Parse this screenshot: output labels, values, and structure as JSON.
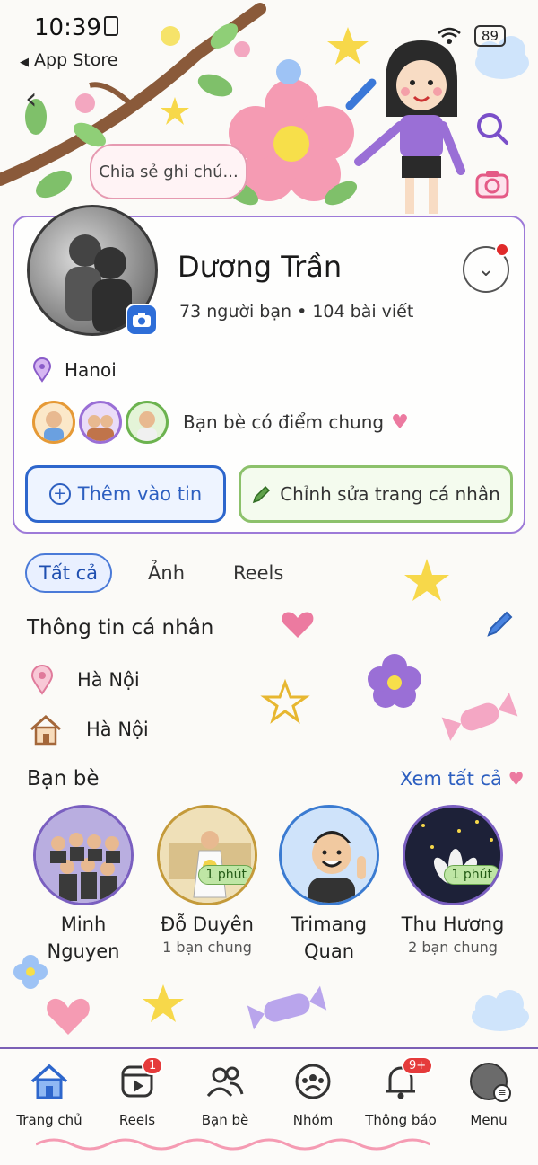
{
  "status_bar": {
    "time": "10:39",
    "back_app": "App Store",
    "battery": "89"
  },
  "header": {
    "note_placeholder": "Chia sẻ ghi chú..."
  },
  "profile": {
    "name": "Dương Trần",
    "stats": "73 người bạn • 104 bài viết",
    "location": "Hanoi",
    "mutual_text": "Bạn bè có điểm chung"
  },
  "actions": {
    "add_story": "Thêm vào tin",
    "edit_profile": "Chỉnh sửa trang cá nhân"
  },
  "tabs": [
    {
      "label": "Tất cả",
      "active": true
    },
    {
      "label": "Ảnh",
      "active": false
    },
    {
      "label": "Reels",
      "active": false
    }
  ],
  "personal_info": {
    "title": "Thông tin cá nhân",
    "rows": [
      {
        "icon": "map-pin-icon",
        "text": "Hà Nội"
      },
      {
        "icon": "home-icon",
        "text": "Hà Nội"
      }
    ]
  },
  "friends": {
    "title": "Bạn bè",
    "see_all": "Xem tất cả",
    "items": [
      {
        "name": "Minh Nguyen",
        "mutual": "",
        "time": "",
        "ring": "#7a5fc0"
      },
      {
        "name": "Đỗ Duyên",
        "mutual": "1 bạn chung",
        "time": "1 phút",
        "ring": "#c49a3a"
      },
      {
        "name": "Trimang Quan",
        "mutual": "",
        "time": "",
        "ring": "#3b7bd1"
      },
      {
        "name": "Thu Hương",
        "mutual": "2 bạn chung",
        "time": "1 phút",
        "ring": "#7a5fc0"
      }
    ]
  },
  "bottom_nav": [
    {
      "label": "Trang chủ",
      "icon": "home-icon",
      "badge": ""
    },
    {
      "label": "Reels",
      "icon": "reels-icon",
      "badge": "1"
    },
    {
      "label": "Bạn bè",
      "icon": "friends-icon",
      "badge": ""
    },
    {
      "label": "Nhóm",
      "icon": "groups-icon",
      "badge": ""
    },
    {
      "label": "Thông báo",
      "icon": "bell-icon",
      "badge": "9+"
    },
    {
      "label": "Menu",
      "icon": "menu-avatar-icon",
      "badge": ""
    }
  ],
  "colors": {
    "accent_blue": "#2d66cc",
    "accent_green": "#8cc16b",
    "card_border": "#9d7ad8",
    "badge_red": "#e53b3b"
  }
}
